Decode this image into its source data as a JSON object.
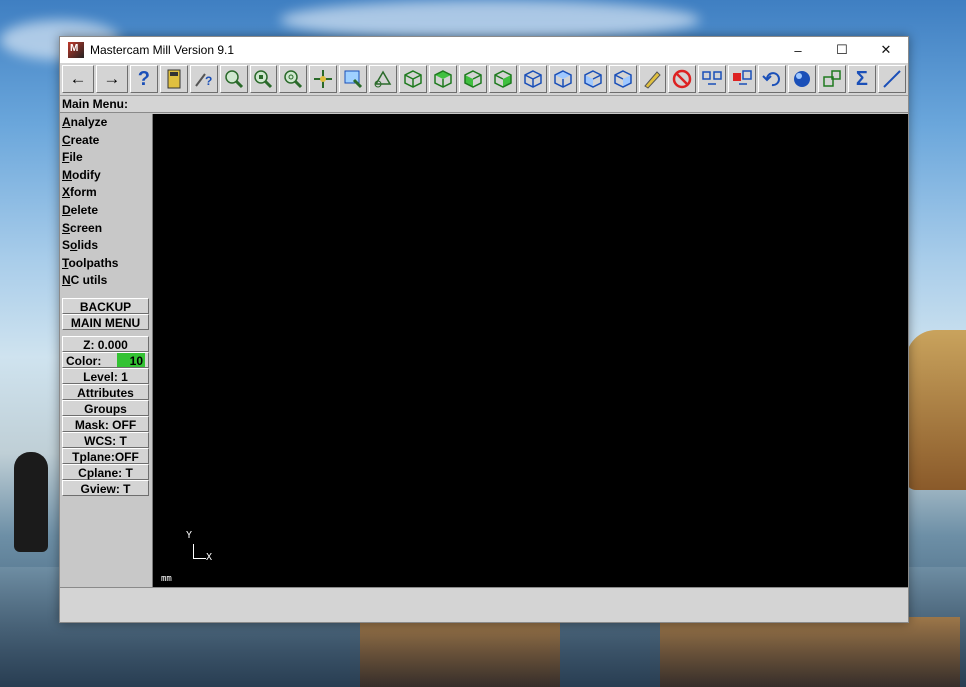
{
  "window": {
    "title": "Mastercam Mill Version 9.1",
    "icon_label": "M"
  },
  "window_controls": {
    "minimize": "–",
    "maximize": "☐",
    "close": "✕"
  },
  "toolbar": {
    "back": "←",
    "forward": "→",
    "help": "?",
    "sum": "Σ"
  },
  "menubar": {
    "title": "Main Menu:"
  },
  "main_menu": [
    {
      "key": "A",
      "rest": "nalyze"
    },
    {
      "key": "C",
      "rest": "reate"
    },
    {
      "key": "F",
      "rest": "ile"
    },
    {
      "key": "M",
      "rest": "odify"
    },
    {
      "key": "X",
      "rest": "form"
    },
    {
      "key": "D",
      "rest": "elete"
    },
    {
      "key": "S",
      "rest": "creen"
    },
    {
      "pre": "S",
      "key": "o",
      "rest": "lids"
    },
    {
      "key": "T",
      "rest": "oolpaths"
    },
    {
      "key": "N",
      "rest": "C utils"
    }
  ],
  "nav_buttons": {
    "backup": "BACKUP",
    "main_menu": "MAIN MENU"
  },
  "status_buttons": {
    "z": "Z:  0.000",
    "color_label": "Color:",
    "color_value": "10",
    "level": "Level:  1",
    "attributes": "Attributes",
    "groups": "Groups",
    "mask": "Mask:  OFF",
    "wcs": "WCS:   T",
    "tplane": "Tplane:OFF",
    "cplane": "Cplane:  T",
    "gview": "Gview:   T"
  },
  "viewport": {
    "axis_y": "Y",
    "axis_x": "X",
    "units": "mm",
    "background": "#000000"
  },
  "colors": {
    "current_color": "#33c233"
  }
}
